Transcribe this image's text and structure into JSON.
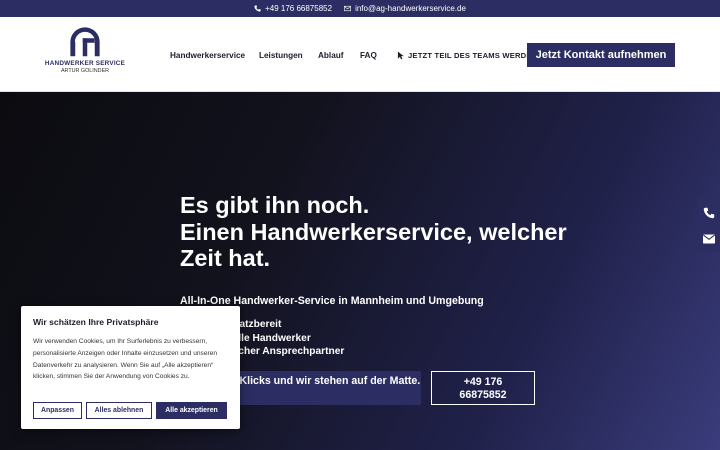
{
  "topbar": {
    "phone": "+49 176 66875852",
    "email": "info@ag-handwerkerservice.de"
  },
  "logo": {
    "line1": "HANDWERKER SERVICE",
    "line2": "ARTUR GOLINDER"
  },
  "nav": {
    "items": [
      "Handwerkerservice",
      "Leistungen",
      "Ablauf",
      "FAQ"
    ],
    "team_link": "JETZT TEIL DES TEAMS WERDEN",
    "cta": "Jetzt Kontakt aufnehmen"
  },
  "hero": {
    "headline_1": "Es gibt ihn noch.",
    "headline_2": "Einen Handwerkerservice, welcher",
    "headline_3": "Zeit hat.",
    "subline": "All-In-One Handwerker-Service in Mannheim und Umgebung",
    "bullets": [
      "Schnell einsatzbereit",
      "Professionelle Handwerker",
      "Ein persönlicher Ansprechpartner"
    ],
    "primary_button": "Ein paar Klicks und wir stehen auf der Matte.",
    "phone_button_1": "+49 176",
    "phone_button_2": "66875852"
  },
  "cookie": {
    "title": "Wir schätzen Ihre Privatsphäre",
    "text": "Wir verwenden Cookies, um Ihr Surferlebnis zu verbessern, personalisierte Anzeigen oder Inhalte einzusetzen und unseren Datenverkehr zu analysieren. Wenn Sie auf „Alle akzeptieren“ klicken, stimmen Sie der Anwendung von Cookies zu.",
    "customize": "Anpassen",
    "reject": "Alles ablehnen",
    "accept": "Alle akzeptieren"
  },
  "colors": {
    "brand": "#2c2e63",
    "white": "#ffffff"
  }
}
